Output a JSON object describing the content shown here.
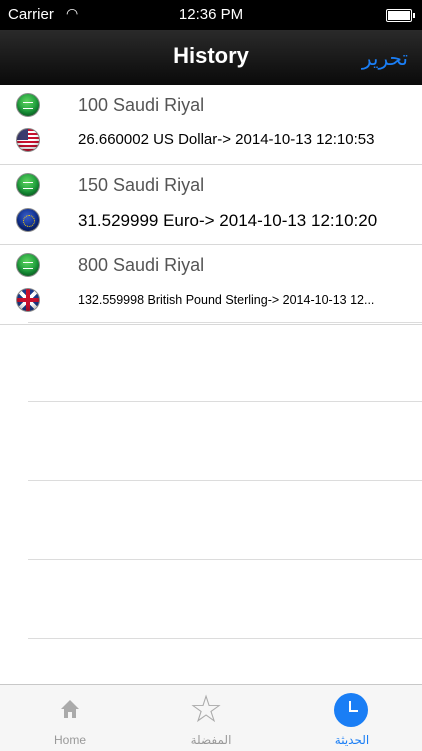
{
  "status_bar": {
    "carrier": "Carrier",
    "time": "12:36 PM"
  },
  "nav": {
    "title": "History",
    "edit_label": "تحرير"
  },
  "history": [
    {
      "from_flag": "saudi-arabia-flag-icon",
      "amount": "100 Saudi Riyal",
      "to_flag": "united-states-flag-icon",
      "result": "26.660002 US Dollar-> 2014-10-13 12:10:53"
    },
    {
      "from_flag": "saudi-arabia-flag-icon",
      "amount": "150 Saudi Riyal",
      "to_flag": "european-union-flag-icon",
      "result": "31.529999 Euro-> 2014-10-13 12:10:20"
    },
    {
      "from_flag": "saudi-arabia-flag-icon",
      "amount": "800 Saudi Riyal",
      "to_flag": "united-kingdom-flag-icon",
      "result": "132.559998 British Pound Sterling-> 2014-10-13 12..."
    }
  ],
  "tabs": [
    {
      "label": "Home",
      "icon": "home-icon",
      "active": false
    },
    {
      "label": "المفضلة",
      "icon": "star-icon",
      "active": false
    },
    {
      "label": "الحديثة",
      "icon": "clock-icon",
      "active": true
    }
  ],
  "colors": {
    "accent": "#1a7ef5",
    "nav_background": "#111111",
    "tab_inactive": "#999999"
  }
}
